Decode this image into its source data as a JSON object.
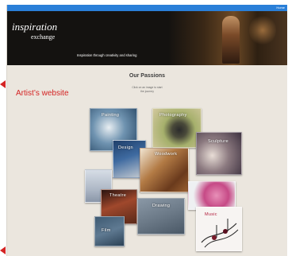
{
  "header": {
    "menu_label": "Home"
  },
  "hero": {
    "logo_main": "inspiration",
    "logo_sub": "exchange",
    "tagline": "Inspiration through creativity and sharing"
  },
  "main": {
    "title": "Our Passions",
    "subtitle_line1": "Click on an image to start",
    "subtitle_line2": "the journey"
  },
  "callout": {
    "text": "Artist’s website",
    "color": "#d42424"
  },
  "tiles": {
    "painting": {
      "label": "Painting"
    },
    "photography": {
      "label": "Photography"
    },
    "design": {
      "label": "Design"
    },
    "woodwork": {
      "label": "Woodwork"
    },
    "sculpture": {
      "label": "Sculpture"
    },
    "still_life": {
      "label": ""
    },
    "theatre": {
      "label": "Theatre"
    },
    "drawing": {
      "label": "Drawing"
    },
    "flowers": {
      "label": ""
    },
    "music": {
      "label": "Music"
    },
    "film": {
      "label": "Film"
    }
  },
  "colors": {
    "topbar": "#2a7fd8",
    "page_bg": "#ebe6de",
    "hero_bg": "#141210",
    "title": "#3c3c3c"
  }
}
